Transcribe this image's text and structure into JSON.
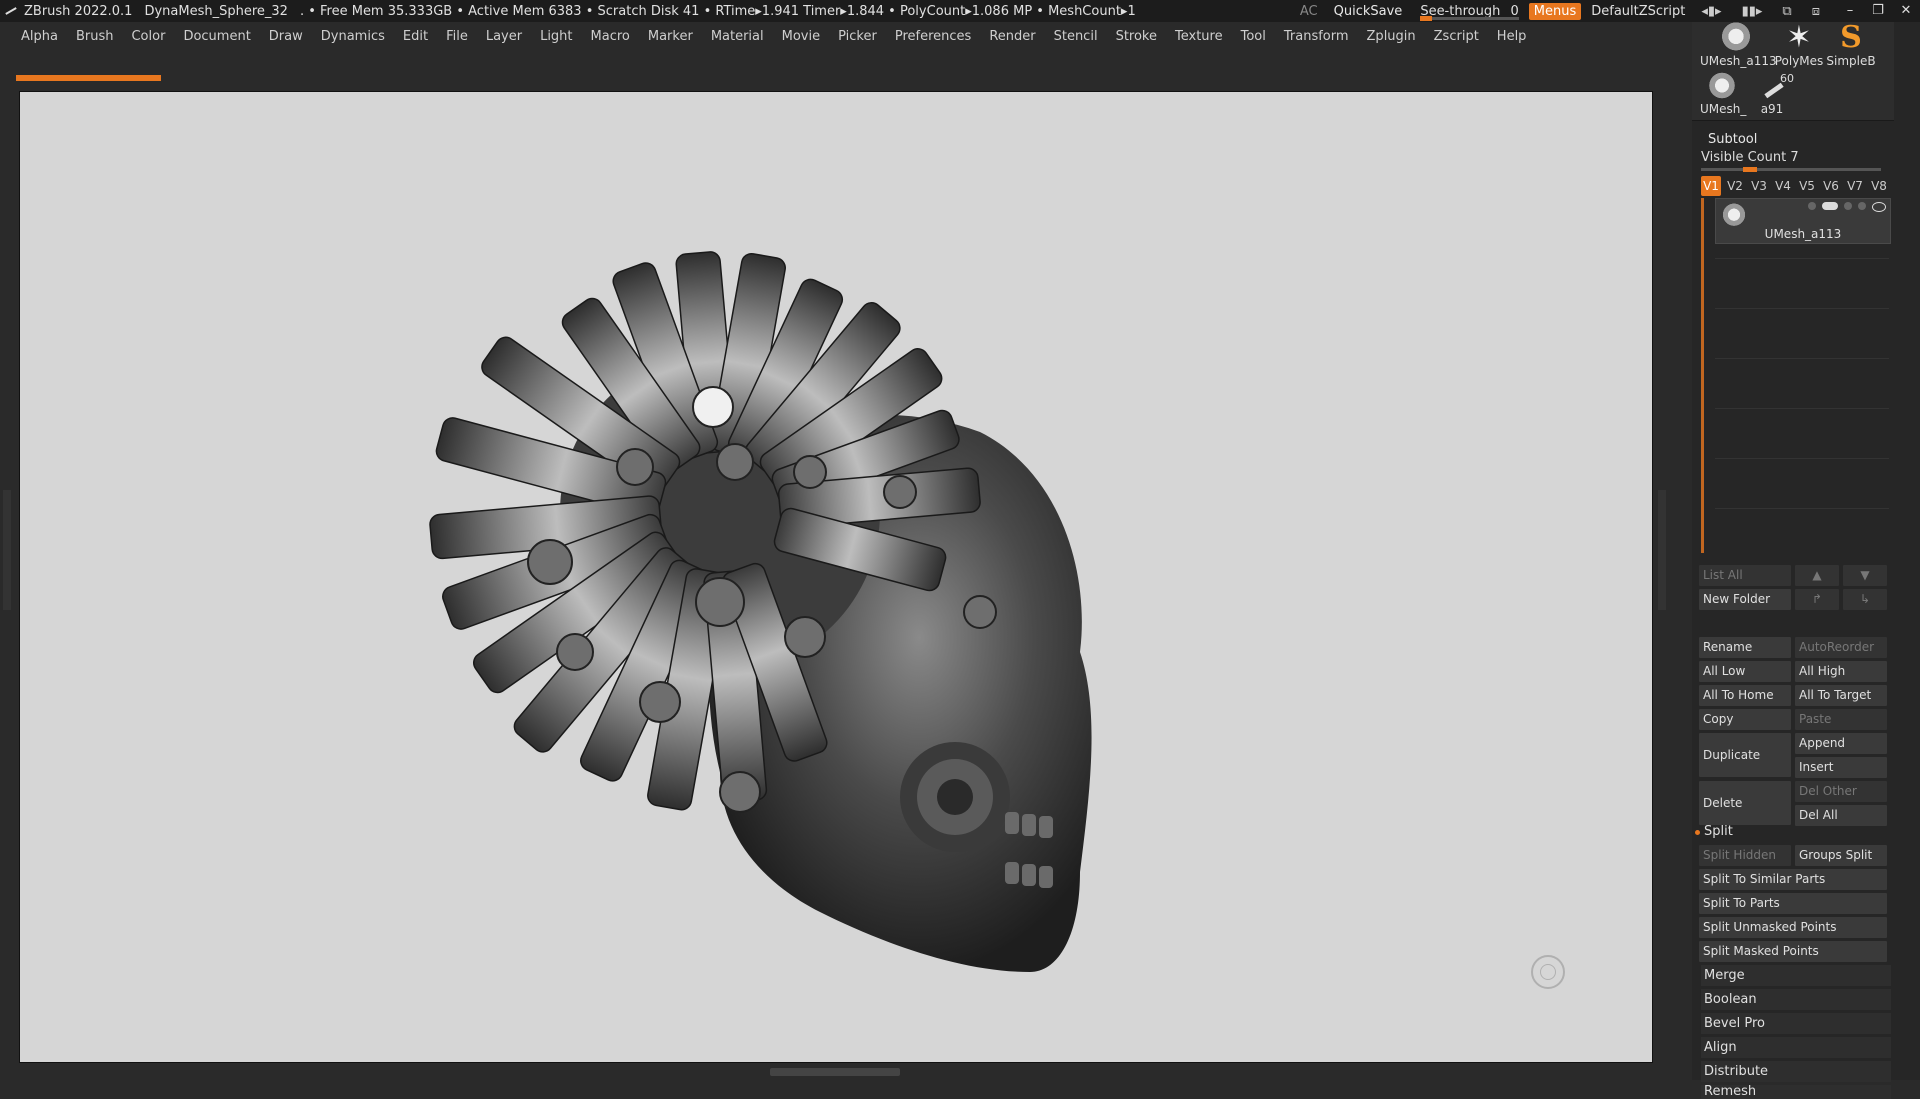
{
  "titlebar": {
    "app": "ZBrush 2022.0.1",
    "project": "DynaMesh_Sphere_32",
    "stats": ". • Free Mem 35.333GB • Active Mem 6383 • Scratch Disk 41 •  RTime▸1.941 Timer▸1.844 • PolyCount▸1.086 MP  • MeshCount▸1",
    "ac": "AC",
    "quicksave": "QuickSave",
    "seethrough_label": "See-through",
    "seethrough_value": "0",
    "menus": "Menus",
    "script": "DefaultZScript",
    "window_controls": [
      "–",
      "❐",
      "✕"
    ]
  },
  "menubar": [
    "Alpha",
    "Brush",
    "Color",
    "Document",
    "Draw",
    "Dynamics",
    "Edit",
    "File",
    "Layer",
    "Light",
    "Macro",
    "Marker",
    "Material",
    "Movie",
    "Picker",
    "Preferences",
    "Render",
    "Stencil",
    "Stroke",
    "Texture",
    "Tool",
    "Transform",
    "Zplugin",
    "Zscript",
    "Help"
  ],
  "tool_thumbs": {
    "t1": "UMesh_a113",
    "t2": "PolyMes",
    "t3": "SimpleB",
    "t4": "UMesh_",
    "t5": "a91",
    "t5_badge": "60"
  },
  "subtool": {
    "title": "Subtool",
    "visible_count": "Visible Count 7",
    "visible_count_level": 0.27,
    "tabs": [
      "V1",
      "V2",
      "V3",
      "V4",
      "V5",
      "V6",
      "V7",
      "V8"
    ],
    "active_tab": "V1",
    "item_name": "UMesh_a113",
    "list_all": "List All",
    "new_folder": "New Folder",
    "rename": "Rename",
    "auto_reorder": "AutoReorder",
    "all_low": "All Low",
    "all_high": "All High",
    "all_to_home": "All To Home",
    "all_to_target": "All To Target",
    "copy": "Copy",
    "paste": "Paste",
    "duplicate": "Duplicate",
    "append": "Append",
    "insert": "Insert",
    "delete": "Delete",
    "del_other": "Del Other",
    "del_all": "Del All",
    "split": "Split",
    "split_hidden": "Split Hidden",
    "groups_split": "Groups Split",
    "split_similar": "Split To Similar Parts",
    "split_parts": "Split To Parts",
    "split_unmasked": "Split Unmasked Points",
    "split_masked": "Split Masked Points",
    "merge": "Merge",
    "boolean": "Boolean",
    "bevel_pro": "Bevel Pro",
    "align": "Align",
    "distribute": "Distribute",
    "remesh": "Remesh"
  },
  "colors": {
    "accent": "#e8771f",
    "canvas": "#d6d6d6",
    "panel": "#262626"
  }
}
